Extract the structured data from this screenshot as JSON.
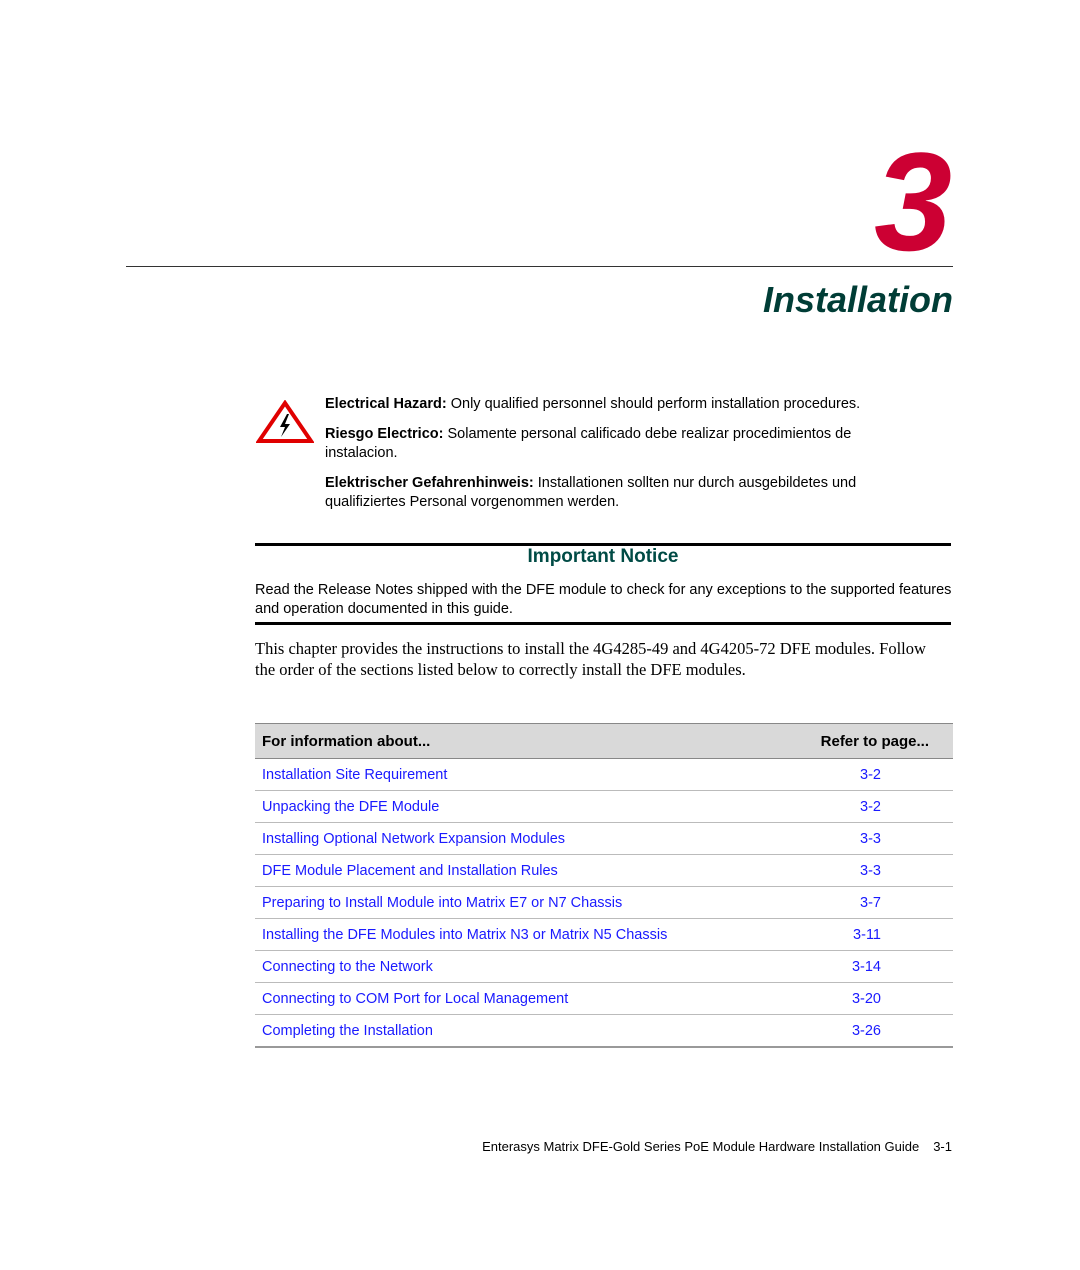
{
  "chapter": {
    "number": "3",
    "title": "Installation"
  },
  "warnings": {
    "icon": "electrical-hazard-icon",
    "items": [
      {
        "label": "Electrical Hazard:",
        "text": " Only qualified personnel should perform installation procedures."
      },
      {
        "label": "Riesgo Electrico:",
        "text": " Solamente personal calificado debe realizar procedimientos de instalacion."
      },
      {
        "label": "Elektrischer Gefahrenhinweis:",
        "text": " Installationen sollten nur durch ausgebildetes und qualifiziertes Personal vorgenommen werden."
      }
    ]
  },
  "notice": {
    "title": "Important Notice",
    "body": "Read the Release Notes shipped with the DFE module to check for any exceptions to the supported features and operation documented in this guide."
  },
  "intro": "This chapter provides the instructions to install the 4G4285-49 and 4G4205-72 DFE modules. Follow the order of the sections listed below to correctly install the DFE modules.",
  "toc": {
    "headers": {
      "topic": "For information about...",
      "page": "Refer to page..."
    },
    "rows": [
      {
        "topic": "Installation Site Requirement",
        "page": "3-2"
      },
      {
        "topic": "Unpacking the DFE Module",
        "page": "3-2"
      },
      {
        "topic": "Installing Optional Network Expansion Modules",
        "page": "3-3"
      },
      {
        "topic": "DFE Module Placement and Installation Rules",
        "page": "3-3"
      },
      {
        "topic": "Preparing to Install Module into Matrix E7 or N7 Chassis",
        "page": "3-7"
      },
      {
        "topic": "Installing the DFE Modules into Matrix N3 or Matrix N5 Chassis",
        "page": "3-11"
      },
      {
        "topic": "Connecting to the Network",
        "page": "3-14"
      },
      {
        "topic": "Connecting to COM Port for Local Management",
        "page": "3-20"
      },
      {
        "topic": "Completing the Installation",
        "page": "3-26"
      }
    ]
  },
  "footer": {
    "guide_title": "Enterasys Matrix DFE-Gold Series PoE Module Hardware Installation Guide",
    "page_number": "3-1"
  },
  "colors": {
    "chapter_number": "#cc0033",
    "title": "#003d36",
    "link": "#1a1aff"
  }
}
